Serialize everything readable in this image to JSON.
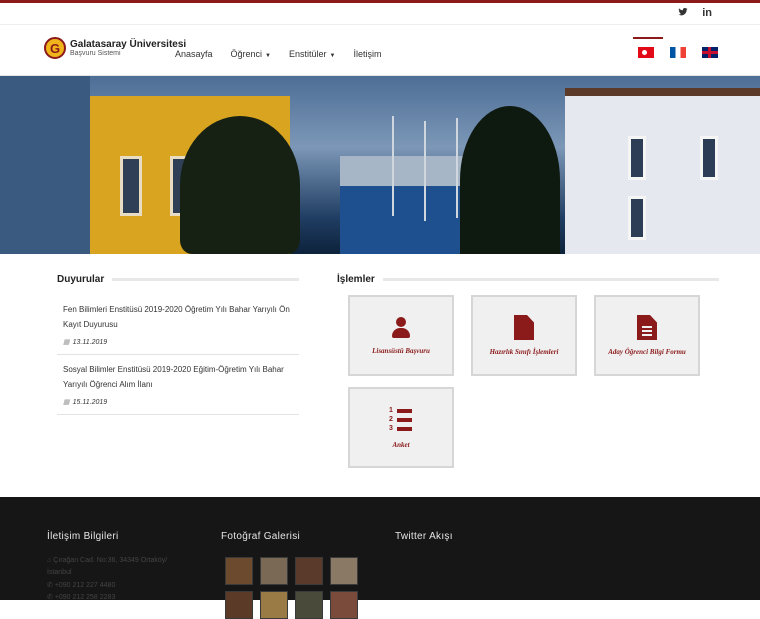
{
  "topbar": {
    "twitter_icon": "twitter-icon",
    "linkedin_icon": "linkedin-icon",
    "linkedin_label": "in",
    "twitter_label": "t"
  },
  "header": {
    "logo_letter": "G",
    "logo_title": "Galatasaray Üniversitesi",
    "logo_subtitle": "Başvuru Sistemi",
    "menu": [
      {
        "label": "Anasayfa",
        "dropdown": false
      },
      {
        "label": "Öğrenci",
        "dropdown": true
      },
      {
        "label": "Enstitüler",
        "dropdown": true
      },
      {
        "label": "İletişim",
        "dropdown": false
      }
    ],
    "languages": [
      "Türkçe",
      "Français",
      "English"
    ]
  },
  "announcements": {
    "title": "Duyurular",
    "items": [
      {
        "title": "Fen Bilimleri Enstitüsü 2019-2020 Öğretim Yılı Bahar Yarıyılı Ön Kayıt Duyurusu",
        "date": "13.11.2019"
      },
      {
        "title": "Sosyal Bilimler Enstitüsü 2019-2020 Eğitim-Öğretim Yılı Bahar Yarıyılı Öğrenci Alım İlanı",
        "date": "15.11.2019"
      }
    ]
  },
  "operations": {
    "title": "İşlemler",
    "tiles": [
      {
        "label": "Lisansüstü Başvuru",
        "icon": "user-icon"
      },
      {
        "label": "Hazırlık Sınıfı İşlemleri",
        "icon": "file-icon"
      },
      {
        "label": "Aday Öğrenci Bilgi Formu",
        "icon": "file-text-icon"
      },
      {
        "label": "Anket",
        "icon": "ordered-list-icon"
      }
    ]
  },
  "footer": {
    "contact_title": "İletişim Bilgileri",
    "address1": "Çırağan Cad. No:36, 34349 Ortaköy/",
    "address2": "İstanbul",
    "phone1": "+090 212 227 4480",
    "phone2": "+090 212 258 2283",
    "gallery_title": "Fotoğraf Galerisi",
    "twitter_title": "Twitter Akışı"
  },
  "colors": {
    "accent": "#8b1a1a",
    "footer_bg": "#161616",
    "tile_bg": "#f0f0f0"
  }
}
